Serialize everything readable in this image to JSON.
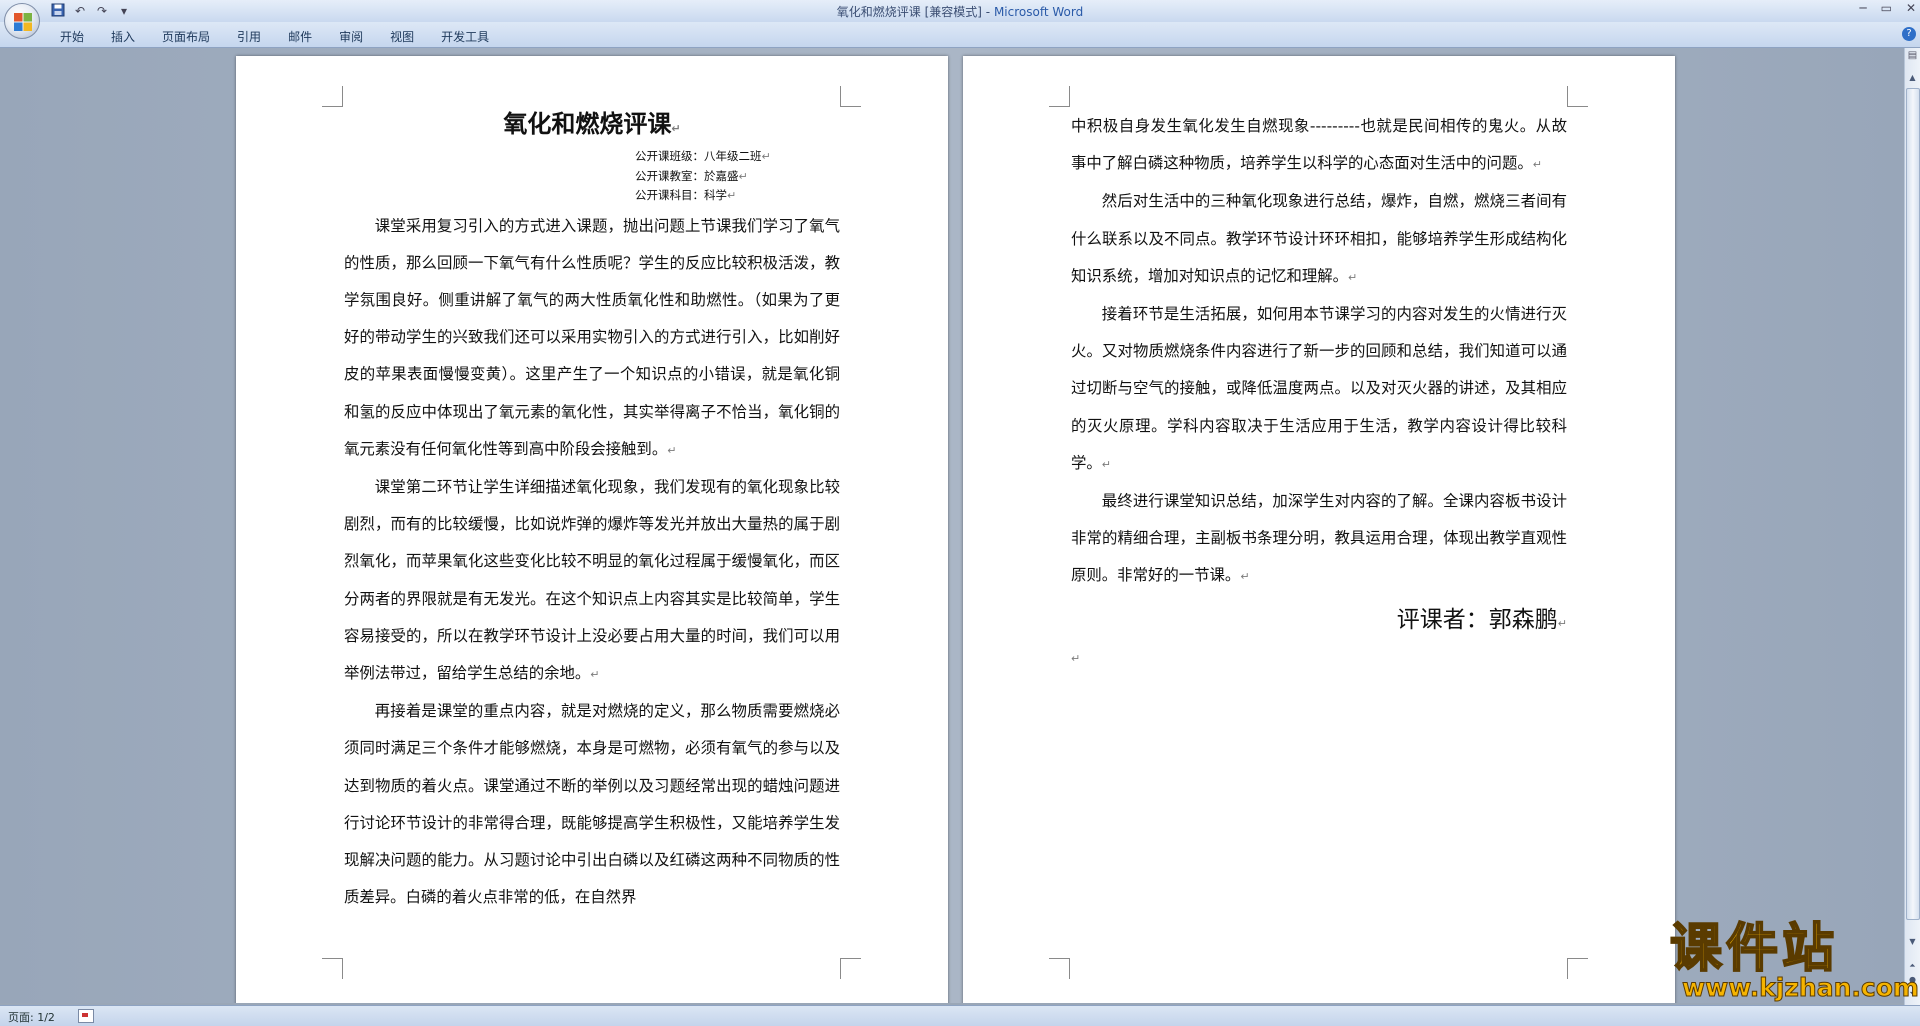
{
  "window": {
    "doc_name": "氧化和燃烧评课 [兼容模式]",
    "separator": " - ",
    "app_name": "Microsoft Word"
  },
  "ribbon": {
    "tabs": [
      "开始",
      "插入",
      "页面布局",
      "引用",
      "邮件",
      "审阅",
      "视图",
      "开发工具"
    ]
  },
  "icons": {
    "office_button": "office-logo-icon",
    "save": "save-icon",
    "undo": "undo-icon",
    "redo": "redo-icon",
    "help": "help-icon"
  },
  "document": {
    "title": "氧化和燃烧评课",
    "meta": [
      "公开课班级：八年级二班",
      "公开课教室：於嘉盛",
      "公开课科目：科学"
    ],
    "left_paragraphs": [
      "课堂采用复习引入的方式进入课题，抛出问题上节课我们学习了氧气的性质，那么回顾一下氧气有什么性质呢？学生的反应比较积极活泼，教学氛围良好。侧重讲解了氧气的两大性质氧化性和助燃性。（如果为了更好的带动学生的兴致我们还可以采用实物引入的方式进行引入，比如削好皮的苹果表面慢慢变黄）。这里产生了一个知识点的小错误，就是氧化铜和氢的反应中体现出了氧元素的氧化性，其实举得离子不恰当，氧化铜的氧元素没有任何氧化性等到高中阶段会接触到。",
      "课堂第二环节让学生详细描述氧化现象，我们发现有的氧化现象比较剧烈，而有的比较缓慢，比如说炸弹的爆炸等发光并放出大量热的属于剧烈氧化，而苹果氧化这些变化比较不明显的氧化过程属于缓慢氧化，而区分两者的界限就是有无发光。在这个知识点上内容其实是比较简单，学生容易接受的，所以在教学环节设计上没必要占用大量的时间，我们可以用举例法带过，留给学生总结的余地。",
      "再接着是课堂的重点内容，就是对燃烧的定义，那么物质需要燃烧必须同时满足三个条件才能够燃烧，本身是可燃物，必须有氧气的参与以及达到物质的着火点。课堂通过不断的举例以及习题经常出现的蜡烛问题进行讨论环节设计的非常得合理，既能够提高学生积极性，又能培养学生发现解决问题的能力。从习题讨论中引出白磷以及红磷这两种不同物质的性质差异。白磷的着火点非常的低，在自然界"
    ],
    "right_paragraphs": [
      "中积极自身发生氧化发生自燃现象---------也就是民间相传的鬼火。从故事中了解白磷这种物质，培养学生以科学的心态面对生活中的问题。",
      "然后对生活中的三种氧化现象进行总结，爆炸，自燃，燃烧三者间有什么联系以及不同点。教学环节设计环环相扣，能够培养学生形成结构化知识系统，增加对知识点的记忆和理解。",
      "接着环节是生活拓展，如何用本节课学习的内容对发生的火情进行灭火。又对物质燃烧条件内容进行了新一步的回顾和总结，我们知道可以通过切断与空气的接触，或降低温度两点。以及对灭火器的讲述，及其相应的灭火原理。学科内容取决于生活应用于生活，教学内容设计得比较科学。",
      "最终进行课堂知识总结，加深学生对内容的了解。全课内容板书设计非常的精细合理，主副板书条理分明，教具运用合理，体现出教学直观性原则。非常好的一节课。"
    ],
    "reviewer": "评课者：郭森鹏",
    "return_mark": "↵"
  },
  "statusbar": {
    "page": "页面: 1/2"
  },
  "watermark": {
    "title": "课件站",
    "url": "www.kjzhan.com"
  },
  "colors": {
    "ribbon": "#c9d9ef",
    "workspace": "#9aa7b7",
    "page": "#ffffff",
    "watermark": "#f6b400"
  }
}
